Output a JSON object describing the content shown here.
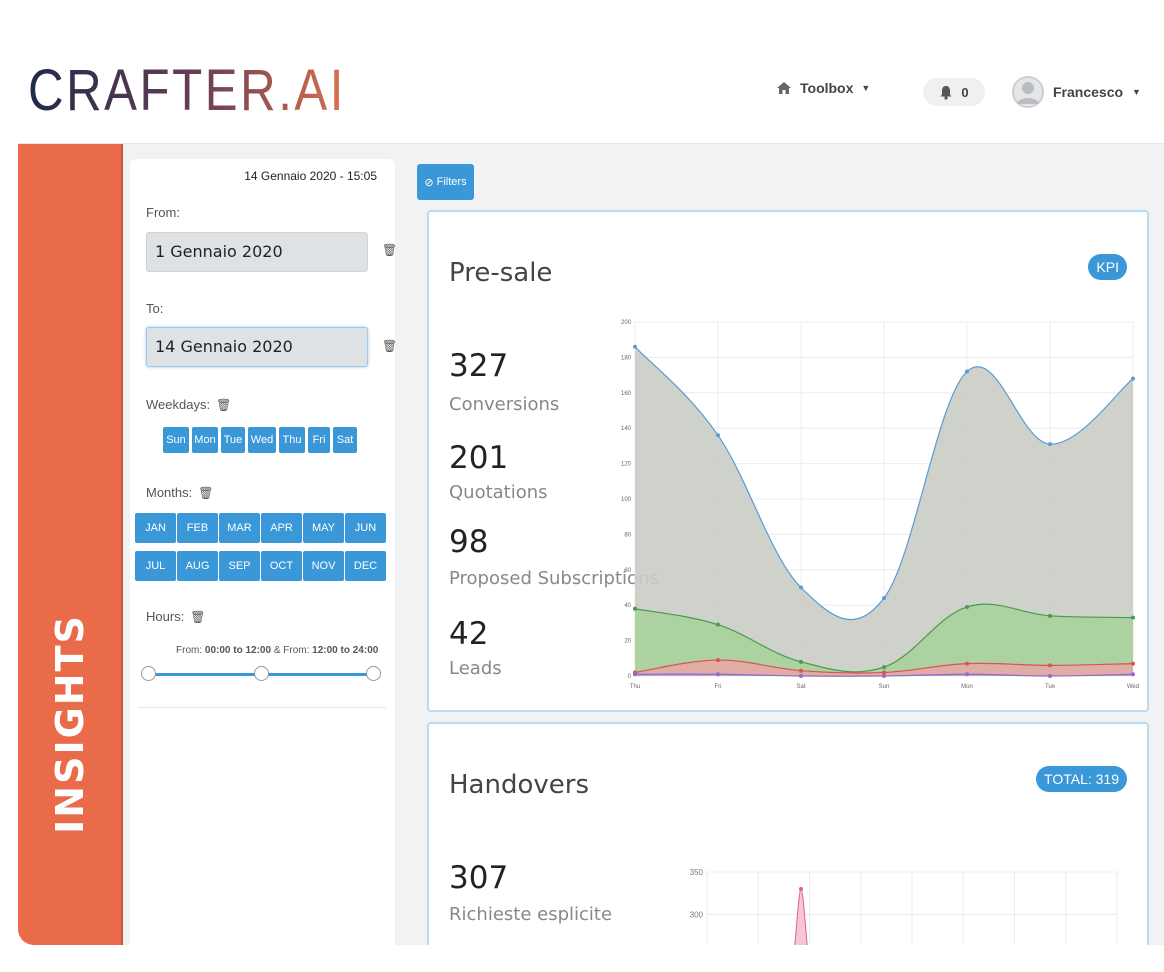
{
  "app": {
    "logo_text": "CRAFTER.AI",
    "side_label": "INSIGHTS"
  },
  "topbar": {
    "toolbox_label": "Toolbox",
    "notifications_count": "0",
    "user_name": "Francesco",
    "icons": {
      "toolbox": "home-icon",
      "notifications": "bell-icon",
      "user": "avatar-icon"
    }
  },
  "filters": {
    "timestamp": "14 Gennaio 2020 - 15:05",
    "from_label": "From:",
    "from_value": "1 Gennaio 2020",
    "to_label": "To:",
    "to_value": "14 Gennaio 2020",
    "weekdays_label": "Weekdays:",
    "weekdays": [
      "Sun",
      "Mon",
      "Tue",
      "Wed",
      "Thu",
      "Fri",
      "Sat"
    ],
    "months_label": "Months:",
    "months": [
      "JAN",
      "FEB",
      "MAR",
      "APR",
      "MAY",
      "JUN",
      "JUL",
      "AUG",
      "SEP",
      "OCT",
      "NOV",
      "DEC"
    ],
    "hours_label": "Hours:",
    "hours_range_1_prefix": "From:",
    "hours_range_1": "00:00 to 12:00",
    "hours_sep": "&",
    "hours_range_2_prefix": "From:",
    "hours_range_2": "12:00 to 24:00",
    "filters_button": "Filters"
  },
  "presale": {
    "title": "Pre-sale",
    "badge": "KPI",
    "kpis": [
      {
        "value": "327",
        "label": "Conversions"
      },
      {
        "value": "201",
        "label": "Quotations"
      },
      {
        "value": "98",
        "label": "Proposed Subscriptions"
      },
      {
        "value": "42",
        "label": "Leads"
      }
    ]
  },
  "handovers": {
    "title": "Handovers",
    "badge": "TOTAL: 319",
    "kpis": [
      {
        "value": "307",
        "label": "Richieste esplicite"
      }
    ]
  },
  "chart_data": [
    {
      "type": "area",
      "categories": [
        "Thu",
        "Fri",
        "Sat",
        "Sun",
        "Mon",
        "Tue",
        "Wed"
      ],
      "ylim": [
        0,
        200
      ],
      "yticks": [
        0,
        20,
        40,
        60,
        80,
        100,
        120,
        140,
        160,
        180,
        200
      ],
      "grid": true,
      "series": [
        {
          "values": [
            186,
            136,
            50,
            44,
            172,
            131,
            168
          ],
          "color": "#5b9bd5",
          "fill": "#c9cdc4"
        },
        {
          "values": [
            38,
            29,
            8,
            5,
            39,
            34,
            33
          ],
          "color": "#4c9a4c",
          "fill": "#a9d29c"
        },
        {
          "values": [
            2,
            9,
            3,
            2,
            7,
            6,
            7
          ],
          "color": "#d9534f",
          "fill": "#e6a9a6"
        },
        {
          "values": [
            1,
            1,
            0,
            0,
            1,
            0,
            1
          ],
          "color": "#8e6cc8",
          "fill": "#b8a4dc"
        }
      ]
    },
    {
      "type": "area",
      "yticks": [
        300,
        350
      ],
      "grid": true,
      "series": [
        {
          "values": [
            0,
            0,
            330,
            0
          ],
          "color": "#e0648a",
          "fill": "#f6c6d3"
        }
      ]
    }
  ]
}
